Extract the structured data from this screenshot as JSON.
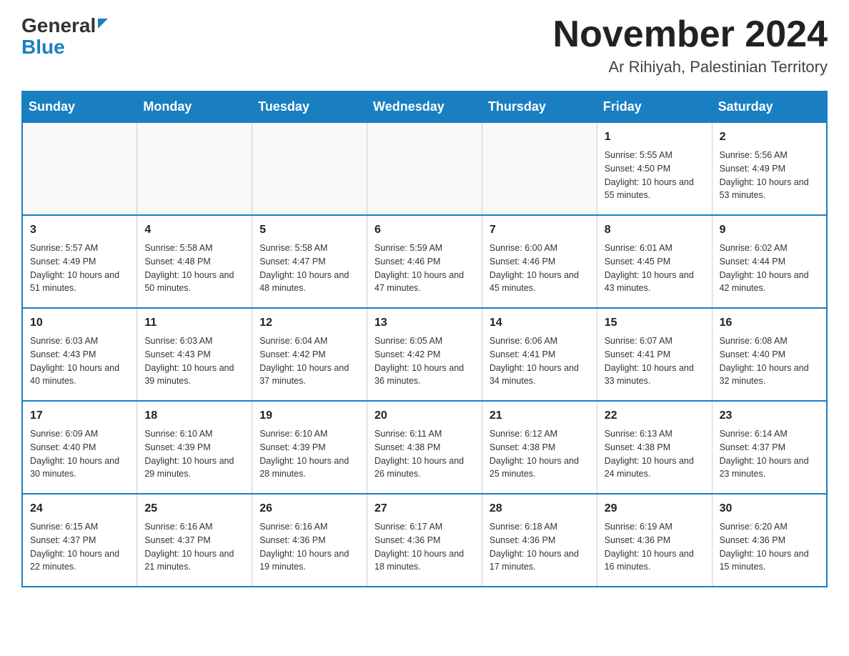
{
  "header": {
    "logo_general": "General",
    "logo_blue": "Blue",
    "month_title": "November 2024",
    "location": "Ar Rihiyah, Palestinian Territory"
  },
  "days_of_week": [
    "Sunday",
    "Monday",
    "Tuesday",
    "Wednesday",
    "Thursday",
    "Friday",
    "Saturday"
  ],
  "weeks": [
    [
      {
        "day": "",
        "info": ""
      },
      {
        "day": "",
        "info": ""
      },
      {
        "day": "",
        "info": ""
      },
      {
        "day": "",
        "info": ""
      },
      {
        "day": "",
        "info": ""
      },
      {
        "day": "1",
        "info": "Sunrise: 5:55 AM\nSunset: 4:50 PM\nDaylight: 10 hours and 55 minutes."
      },
      {
        "day": "2",
        "info": "Sunrise: 5:56 AM\nSunset: 4:49 PM\nDaylight: 10 hours and 53 minutes."
      }
    ],
    [
      {
        "day": "3",
        "info": "Sunrise: 5:57 AM\nSunset: 4:49 PM\nDaylight: 10 hours and 51 minutes."
      },
      {
        "day": "4",
        "info": "Sunrise: 5:58 AM\nSunset: 4:48 PM\nDaylight: 10 hours and 50 minutes."
      },
      {
        "day": "5",
        "info": "Sunrise: 5:58 AM\nSunset: 4:47 PM\nDaylight: 10 hours and 48 minutes."
      },
      {
        "day": "6",
        "info": "Sunrise: 5:59 AM\nSunset: 4:46 PM\nDaylight: 10 hours and 47 minutes."
      },
      {
        "day": "7",
        "info": "Sunrise: 6:00 AM\nSunset: 4:46 PM\nDaylight: 10 hours and 45 minutes."
      },
      {
        "day": "8",
        "info": "Sunrise: 6:01 AM\nSunset: 4:45 PM\nDaylight: 10 hours and 43 minutes."
      },
      {
        "day": "9",
        "info": "Sunrise: 6:02 AM\nSunset: 4:44 PM\nDaylight: 10 hours and 42 minutes."
      }
    ],
    [
      {
        "day": "10",
        "info": "Sunrise: 6:03 AM\nSunset: 4:43 PM\nDaylight: 10 hours and 40 minutes."
      },
      {
        "day": "11",
        "info": "Sunrise: 6:03 AM\nSunset: 4:43 PM\nDaylight: 10 hours and 39 minutes."
      },
      {
        "day": "12",
        "info": "Sunrise: 6:04 AM\nSunset: 4:42 PM\nDaylight: 10 hours and 37 minutes."
      },
      {
        "day": "13",
        "info": "Sunrise: 6:05 AM\nSunset: 4:42 PM\nDaylight: 10 hours and 36 minutes."
      },
      {
        "day": "14",
        "info": "Sunrise: 6:06 AM\nSunset: 4:41 PM\nDaylight: 10 hours and 34 minutes."
      },
      {
        "day": "15",
        "info": "Sunrise: 6:07 AM\nSunset: 4:41 PM\nDaylight: 10 hours and 33 minutes."
      },
      {
        "day": "16",
        "info": "Sunrise: 6:08 AM\nSunset: 4:40 PM\nDaylight: 10 hours and 32 minutes."
      }
    ],
    [
      {
        "day": "17",
        "info": "Sunrise: 6:09 AM\nSunset: 4:40 PM\nDaylight: 10 hours and 30 minutes."
      },
      {
        "day": "18",
        "info": "Sunrise: 6:10 AM\nSunset: 4:39 PM\nDaylight: 10 hours and 29 minutes."
      },
      {
        "day": "19",
        "info": "Sunrise: 6:10 AM\nSunset: 4:39 PM\nDaylight: 10 hours and 28 minutes."
      },
      {
        "day": "20",
        "info": "Sunrise: 6:11 AM\nSunset: 4:38 PM\nDaylight: 10 hours and 26 minutes."
      },
      {
        "day": "21",
        "info": "Sunrise: 6:12 AM\nSunset: 4:38 PM\nDaylight: 10 hours and 25 minutes."
      },
      {
        "day": "22",
        "info": "Sunrise: 6:13 AM\nSunset: 4:38 PM\nDaylight: 10 hours and 24 minutes."
      },
      {
        "day": "23",
        "info": "Sunrise: 6:14 AM\nSunset: 4:37 PM\nDaylight: 10 hours and 23 minutes."
      }
    ],
    [
      {
        "day": "24",
        "info": "Sunrise: 6:15 AM\nSunset: 4:37 PM\nDaylight: 10 hours and 22 minutes."
      },
      {
        "day": "25",
        "info": "Sunrise: 6:16 AM\nSunset: 4:37 PM\nDaylight: 10 hours and 21 minutes."
      },
      {
        "day": "26",
        "info": "Sunrise: 6:16 AM\nSunset: 4:36 PM\nDaylight: 10 hours and 19 minutes."
      },
      {
        "day": "27",
        "info": "Sunrise: 6:17 AM\nSunset: 4:36 PM\nDaylight: 10 hours and 18 minutes."
      },
      {
        "day": "28",
        "info": "Sunrise: 6:18 AM\nSunset: 4:36 PM\nDaylight: 10 hours and 17 minutes."
      },
      {
        "day": "29",
        "info": "Sunrise: 6:19 AM\nSunset: 4:36 PM\nDaylight: 10 hours and 16 minutes."
      },
      {
        "day": "30",
        "info": "Sunrise: 6:20 AM\nSunset: 4:36 PM\nDaylight: 10 hours and 15 minutes."
      }
    ]
  ]
}
